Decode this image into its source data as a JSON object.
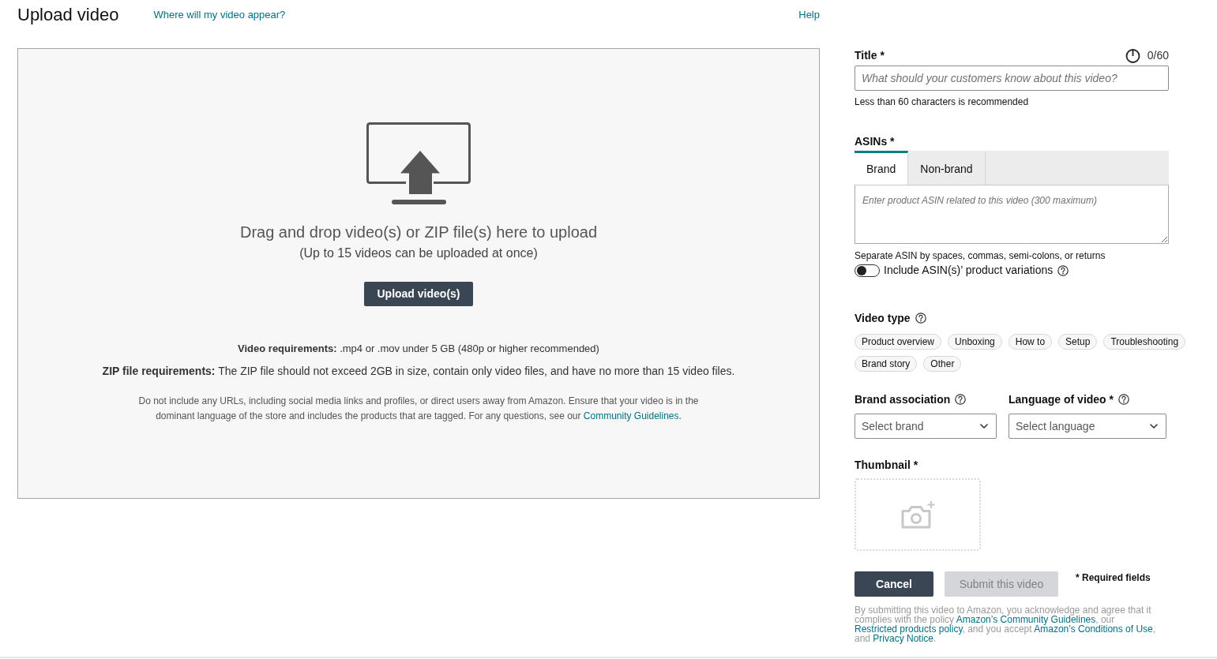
{
  "header": {
    "title": "Upload video",
    "link": "Where will my video appear?",
    "help": "Help"
  },
  "dropzone": {
    "headline": "Drag and drop video(s) or ZIP file(s) here to upload",
    "subline": "(Up to 15 videos can be uploaded at once)",
    "button": "Upload video(s)",
    "requirements": [
      "**Video requirements:** .mp4 or .mov under 5 GB (480p or higher recommended)",
      "**ZIP file requirements:** The ZIP file should not exceed 2GB in size, contain only video files, and have no more than 15 video files."
    ],
    "notice": [
      {
        "kind": "text",
        "text": "Do not include any URLs, including social media links and profiles, or direct users away from Amazon. Ensure that your video is in the dominant language of the store and includes the products that are tagged. For any questions, see our "
      },
      {
        "kind": "link",
        "text": "Community Guidelines"
      },
      {
        "kind": "text",
        "text": "."
      }
    ]
  },
  "form": {
    "title": {
      "label": "Title *",
      "counter": "0/60",
      "placeholder": "What should your customers know about this video?",
      "hint": "Less than 60 characters is recommended"
    },
    "asins": {
      "label": "ASINs *",
      "tabs": [
        {
          "label": "Brand",
          "selected": true
        },
        {
          "label": "Non-brand",
          "selected": false
        }
      ],
      "placeholder": "Enter product ASIN related to this video (300 maximum)",
      "hint": "Separate ASIN by spaces, commas, semi-colons, or returns",
      "variations": {
        "label": "Include ASIN(s)’ product variations",
        "on": false
      }
    },
    "video_type": {
      "label": "Video type",
      "options": [
        {
          "label": "Product overview",
          "selected": false
        },
        {
          "label": "Unboxing",
          "selected": false
        },
        {
          "label": "How to",
          "selected": false
        },
        {
          "label": "Setup",
          "selected": false
        },
        {
          "label": "Troubleshooting",
          "selected": false
        },
        {
          "label": "Brand story",
          "selected": false
        },
        {
          "label": "Other",
          "selected": false
        }
      ]
    },
    "brand_association": {
      "label": "Brand association",
      "prompt": "Select brand"
    },
    "language": {
      "label": "Language of video *",
      "prompt": "Select language"
    },
    "thumbnail": {
      "label": "Thumbnail *"
    },
    "buttons": {
      "cancel": "Cancel",
      "submit": {
        "label": "Submit this video",
        "disabled": true
      }
    },
    "required_note": "* Required fields",
    "legal": [
      {
        "kind": "text",
        "text": "By submitting this video to Amazon, you acknowledge and agree that it complies with the policy "
      },
      {
        "kind": "link",
        "text": "Amazon’s Community Guidelines"
      },
      {
        "kind": "text",
        "text": ", our "
      },
      {
        "kind": "link",
        "text": "Restricted products policy"
      },
      {
        "kind": "text",
        "text": ", and you accept "
      },
      {
        "kind": "link",
        "text": "Amazon’s Conditions of Use"
      },
      {
        "kind": "text",
        "text": ", and "
      },
      {
        "kind": "link",
        "text": "Privacy Notice"
      },
      {
        "kind": "text",
        "text": "."
      }
    ]
  }
}
